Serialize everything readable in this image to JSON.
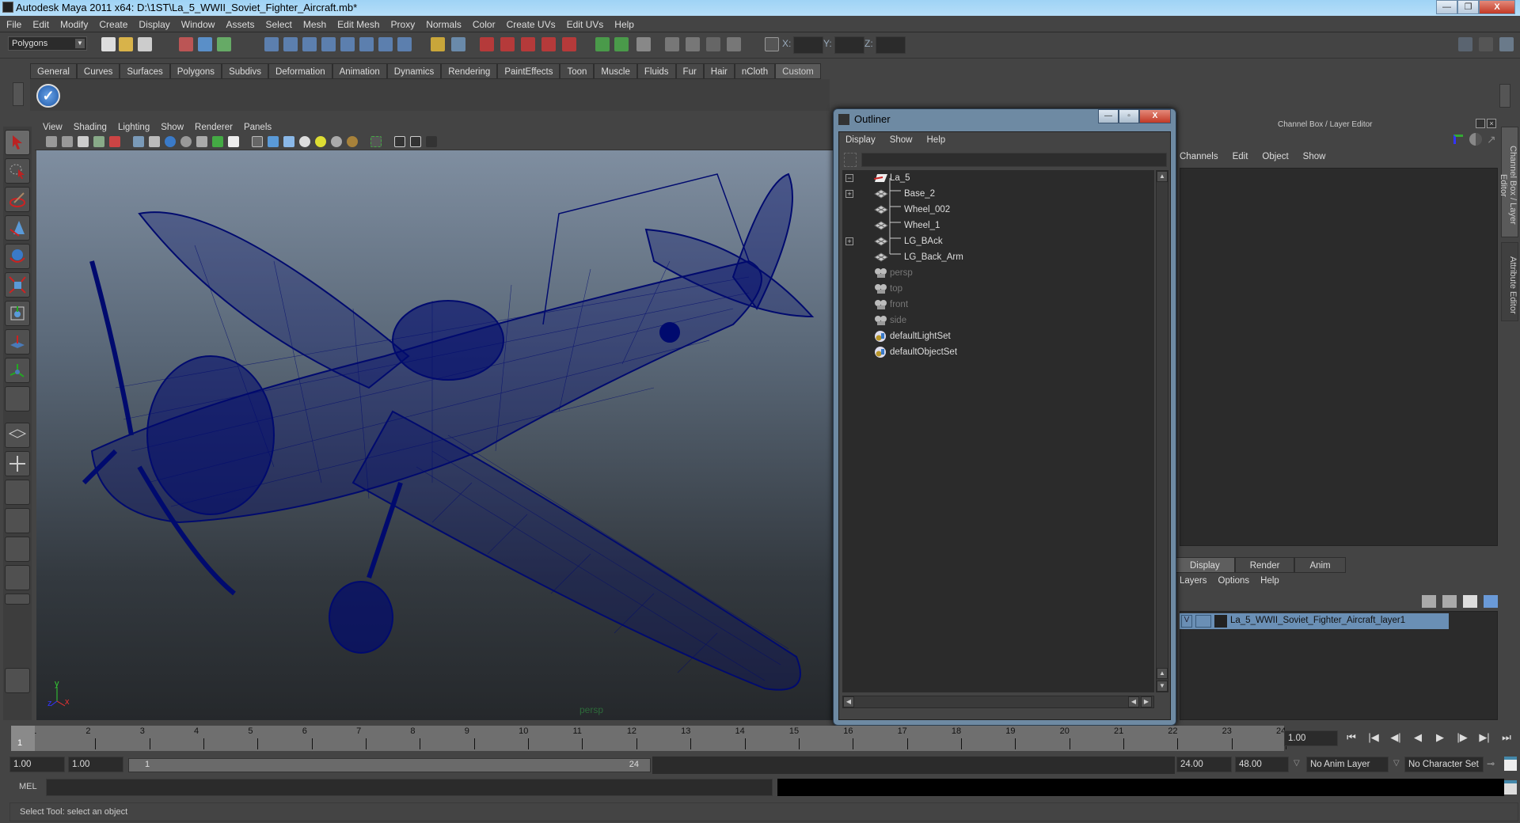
{
  "window": {
    "title": "Autodesk Maya 2011 x64: D:\\1ST\\La_5_WWII_Soviet_Fighter_Aircraft.mb*",
    "min": "—",
    "max": "❐",
    "close": "X"
  },
  "menubar": [
    "File",
    "Edit",
    "Modify",
    "Create",
    "Display",
    "Window",
    "Assets",
    "Select",
    "Mesh",
    "Edit Mesh",
    "Proxy",
    "Normals",
    "Color",
    "Create UVs",
    "Edit UVs",
    "Help"
  ],
  "statusline": {
    "mode": "Polygons",
    "x_label": "X:",
    "y_label": "Y:",
    "z_label": "Z:"
  },
  "shelf": {
    "tabs": [
      "General",
      "Curves",
      "Surfaces",
      "Polygons",
      "Subdivs",
      "Deformation",
      "Animation",
      "Dynamics",
      "Rendering",
      "PaintEffects",
      "Toon",
      "Muscle",
      "Fluids",
      "Fur",
      "Hair",
      "nCloth",
      "Custom"
    ],
    "active_tab": "Custom",
    "check_icon": "✓"
  },
  "viewport": {
    "menu": [
      "View",
      "Shading",
      "Lighting",
      "Show",
      "Renderer",
      "Panels"
    ],
    "camera_label": "persp",
    "axis": {
      "y": "y",
      "z": "z",
      "x": "x"
    },
    "wire_color": "#000a6e"
  },
  "outliner": {
    "title": "Outliner",
    "menu": [
      "Display",
      "Show",
      "Help"
    ],
    "items": [
      {
        "label": "La_5",
        "expander": "−",
        "icon": "transform",
        "dim": false,
        "child": false
      },
      {
        "label": "Base_2",
        "expander": "+",
        "icon": "mesh",
        "dim": false,
        "child": true
      },
      {
        "label": "Wheel_002",
        "expander": "",
        "icon": "mesh",
        "dim": false,
        "child": true
      },
      {
        "label": "Wheel_1",
        "expander": "",
        "icon": "mesh",
        "dim": false,
        "child": true
      },
      {
        "label": "LG_BAck",
        "expander": "+",
        "icon": "mesh",
        "dim": false,
        "child": true
      },
      {
        "label": "LG_Back_Arm",
        "expander": "",
        "icon": "mesh",
        "dim": false,
        "child": true
      },
      {
        "label": "persp",
        "expander": "",
        "icon": "camera",
        "dim": true,
        "child": false
      },
      {
        "label": "top",
        "expander": "",
        "icon": "camera",
        "dim": true,
        "child": false
      },
      {
        "label": "front",
        "expander": "",
        "icon": "camera",
        "dim": true,
        "child": false
      },
      {
        "label": "side",
        "expander": "",
        "icon": "camera",
        "dim": true,
        "child": false
      },
      {
        "label": "defaultLightSet",
        "expander": "",
        "icon": "set",
        "dim": false,
        "child": false
      },
      {
        "label": "defaultObjectSet",
        "expander": "",
        "icon": "set",
        "dim": false,
        "child": false
      }
    ]
  },
  "channelbox": {
    "header": "Channel Box / Layer Editor",
    "menu": [
      "Channels",
      "Edit",
      "Object",
      "Show"
    ],
    "side_tabs": [
      "Channel Box / Layer Editor",
      "Attribute Editor"
    ]
  },
  "layers": {
    "tabs": [
      "Display",
      "Render",
      "Anim"
    ],
    "active_tab": "Display",
    "menu": [
      "Layers",
      "Options",
      "Help"
    ],
    "row": {
      "visible": "V",
      "name": "La_5_WWII_Soviet_Fighter_Aircraft_layer1"
    }
  },
  "timeline": {
    "ticks": [
      1,
      2,
      3,
      4,
      5,
      6,
      7,
      8,
      9,
      10,
      11,
      12,
      13,
      14,
      15,
      16,
      17,
      18,
      19,
      20,
      21,
      22,
      23,
      24
    ],
    "current_frame": "1",
    "current_time": "1.00",
    "playback": [
      "⏮",
      "|◀",
      "◀|",
      "◀",
      "▶",
      "|▶",
      "▶|",
      "⏭"
    ]
  },
  "range": {
    "start_time": "1.00",
    "playback_start": "1.00",
    "range_start": "1",
    "range_end": "24",
    "playback_end": "24.00",
    "end_time": "48.00",
    "anim_layer": "No Anim Layer",
    "character_set": "No Character Set"
  },
  "cmdline": {
    "label": "MEL",
    "value": ""
  },
  "helpline": "Select Tool: select an object"
}
